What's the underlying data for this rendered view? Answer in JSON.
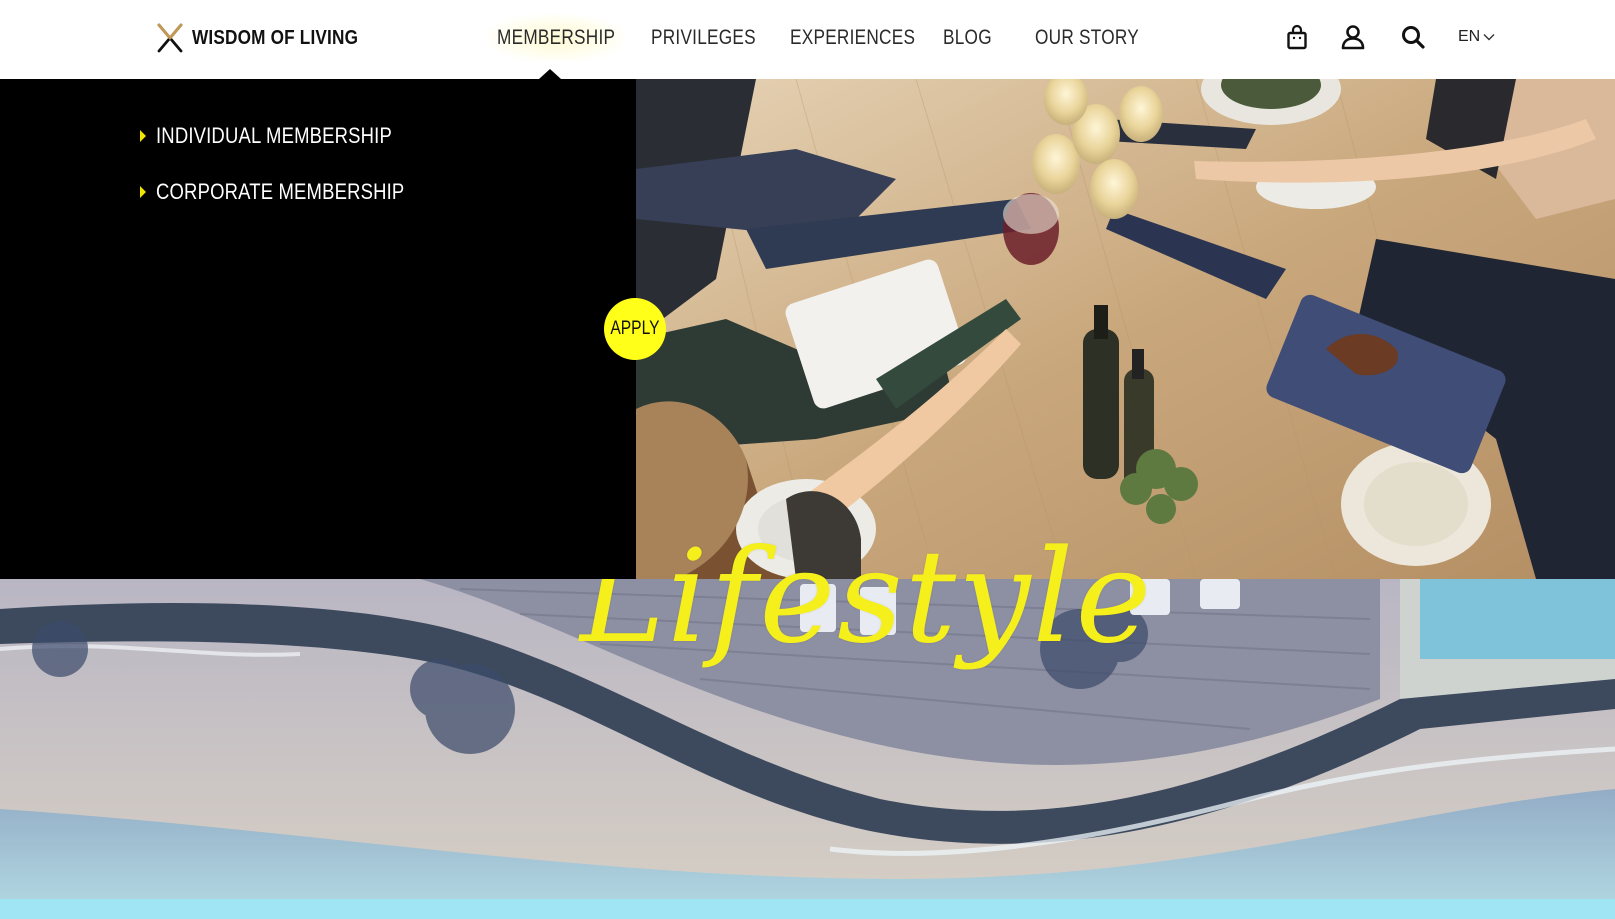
{
  "brand": {
    "name": "WISDOM OF LIVING",
    "accent": "#ffff1a",
    "logo_colors": [
      "#c49a52",
      "#111111"
    ]
  },
  "nav": {
    "items": [
      {
        "label": "MEMBERSHIP",
        "active": true
      },
      {
        "label": "PRIVILEGES",
        "active": false
      },
      {
        "label": "EXPERIENCES",
        "active": false
      },
      {
        "label": "BLOG",
        "active": false
      },
      {
        "label": "OUR STORY",
        "active": false
      }
    ]
  },
  "header_icons": [
    "shopping-bag-icon",
    "user-icon",
    "search-icon"
  ],
  "language": {
    "label": "EN",
    "icon": "chevron-down-icon"
  },
  "dropdown": {
    "items": [
      {
        "label": "INDIVIDUAL MEMBERSHIP"
      },
      {
        "label": "CORPORATE MEMBERSHIP"
      }
    ]
  },
  "apply": {
    "label": "APPLY"
  },
  "hero": {
    "script_text": "Lifestyle",
    "script_color": "#f5ef1c"
  }
}
